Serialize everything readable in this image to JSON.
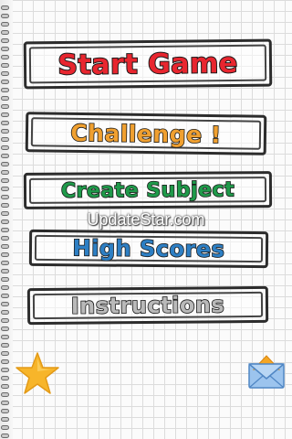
{
  "menu": {
    "start_game": "Start Game",
    "challenge": "Challenge !",
    "create_subject": "Create Subject",
    "high_scores": "High Scores",
    "instructions": "Instructions"
  },
  "watermark": "UpdateStar.com",
  "icons": {
    "star": "star-icon",
    "mail": "mail-icon"
  },
  "colors": {
    "start_game": "#e8262f",
    "challenge": "#f0a030",
    "create_subject": "#1f9a4a",
    "high_scores": "#2d7fc4",
    "instructions": "#b9b9b9",
    "star": "#f7b52a",
    "mail": "#7fb2e6"
  }
}
